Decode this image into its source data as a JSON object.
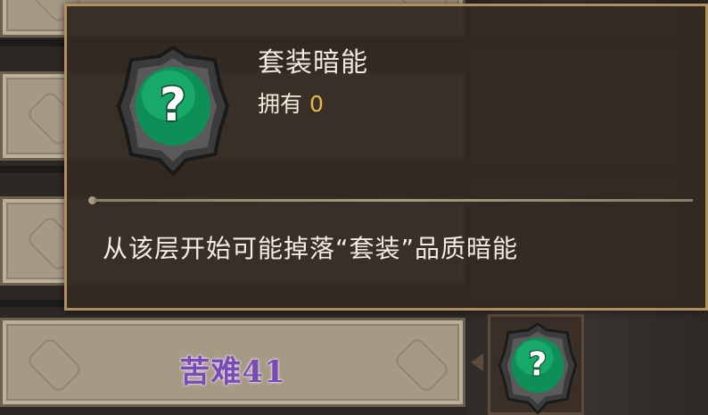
{
  "colors": {
    "tooltip_bg": "#332b22",
    "tooltip_border": "#b0915e",
    "owned_value": "#e6b94a",
    "stage_label": "#7b4bb4",
    "gem": "#12a364"
  },
  "tooltip": {
    "title": "套装暗能",
    "owned_label": "拥有",
    "owned_count": "0",
    "description": "从该层开始可能掉落“套装”品质暗能",
    "icon": "question-gem-icon"
  },
  "stages": [
    {
      "label": "苦难41",
      "icon": "question-gem-icon"
    }
  ]
}
